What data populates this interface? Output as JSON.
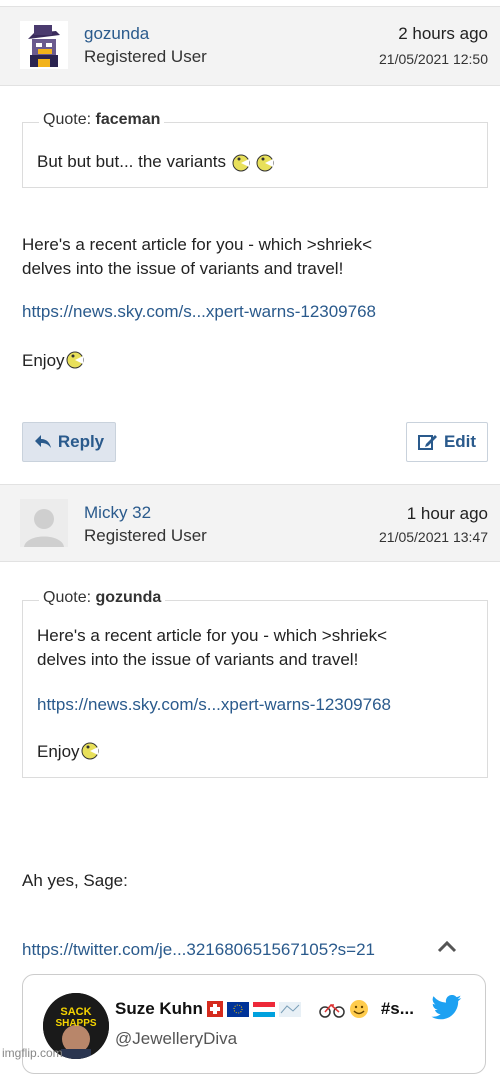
{
  "post1": {
    "username": "gozunda",
    "role": "Registered User",
    "time_ago": "2 hours ago",
    "date": "21/05/2021 12:50",
    "quote_prefix": "Quote:",
    "quote_author": "faceman",
    "quote_text": "But but but... the variants",
    "body_line1": "Here's a recent article for you - which >shriek<",
    "body_line2": "delves into the issue of variants and travel!",
    "link": "https://news.sky.com/s...xpert-warns-12309768",
    "enjoy": "Enjoy",
    "reply_label": "Reply",
    "edit_label": "Edit"
  },
  "post2": {
    "username": "Micky 32",
    "role": "Registered User",
    "time_ago": "1 hour ago",
    "date": "21/05/2021 13:47",
    "quote_prefix": "Quote:",
    "quote_author": "gozunda",
    "quote_line1": "Here's a recent article for you - which >shriek<",
    "quote_line2": "delves into the issue of variants and travel!",
    "quote_link": "https://news.sky.com/s...xpert-warns-12309768",
    "quote_enjoy": "Enjoy",
    "body_text": "Ah yes, Sage:",
    "twitter_link": "https://twitter.com/je...321680651567105?s=21"
  },
  "tweet": {
    "name": "Suze Kuhn",
    "name_suffix": "#s...",
    "handle": "@JewelleryDiva",
    "avatar_text": "SACK SHAPPS",
    "brand_color": "#1da1f2"
  },
  "watermark": "imgflip.com",
  "colors": {
    "link": "#2a5a8c",
    "header_bg": "#f3f3f3",
    "reply_bg": "#dfe5ee"
  }
}
